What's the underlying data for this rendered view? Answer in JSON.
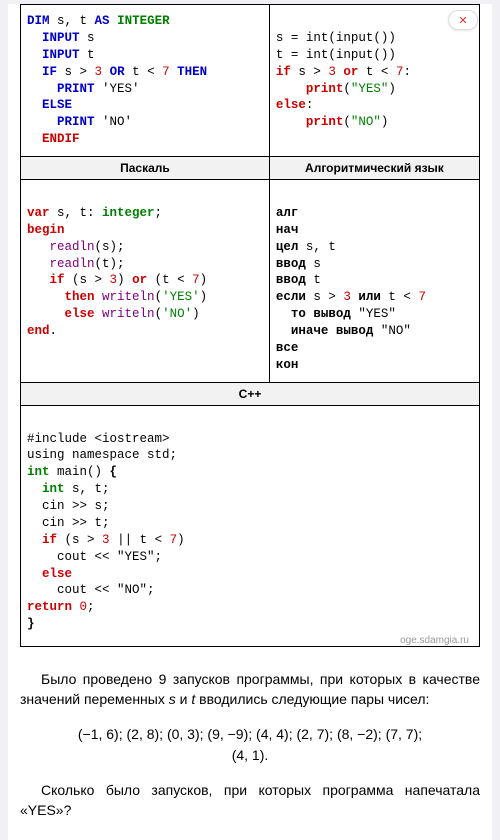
{
  "headers": {
    "pascal": "Паскаль",
    "algo": "Алгоритмический язык",
    "cpp": "С++"
  },
  "watermark": "oge.sdamgia.ru",
  "close_icon": "✕",
  "body_paragraph": "Было проведено 9 запусков программы, при которых в качестве значений переменных s и t вводились следующие пары чисел:",
  "pairs_line1": "(−1, 6); (2, 8); (0, 3); (9, −9); (4, 4); (2, 7); (8, −2); (7, 7);",
  "pairs_line2": "(4, 1).",
  "question": "Сколько было запусков, при которых программа напечатала «YES»?"
}
